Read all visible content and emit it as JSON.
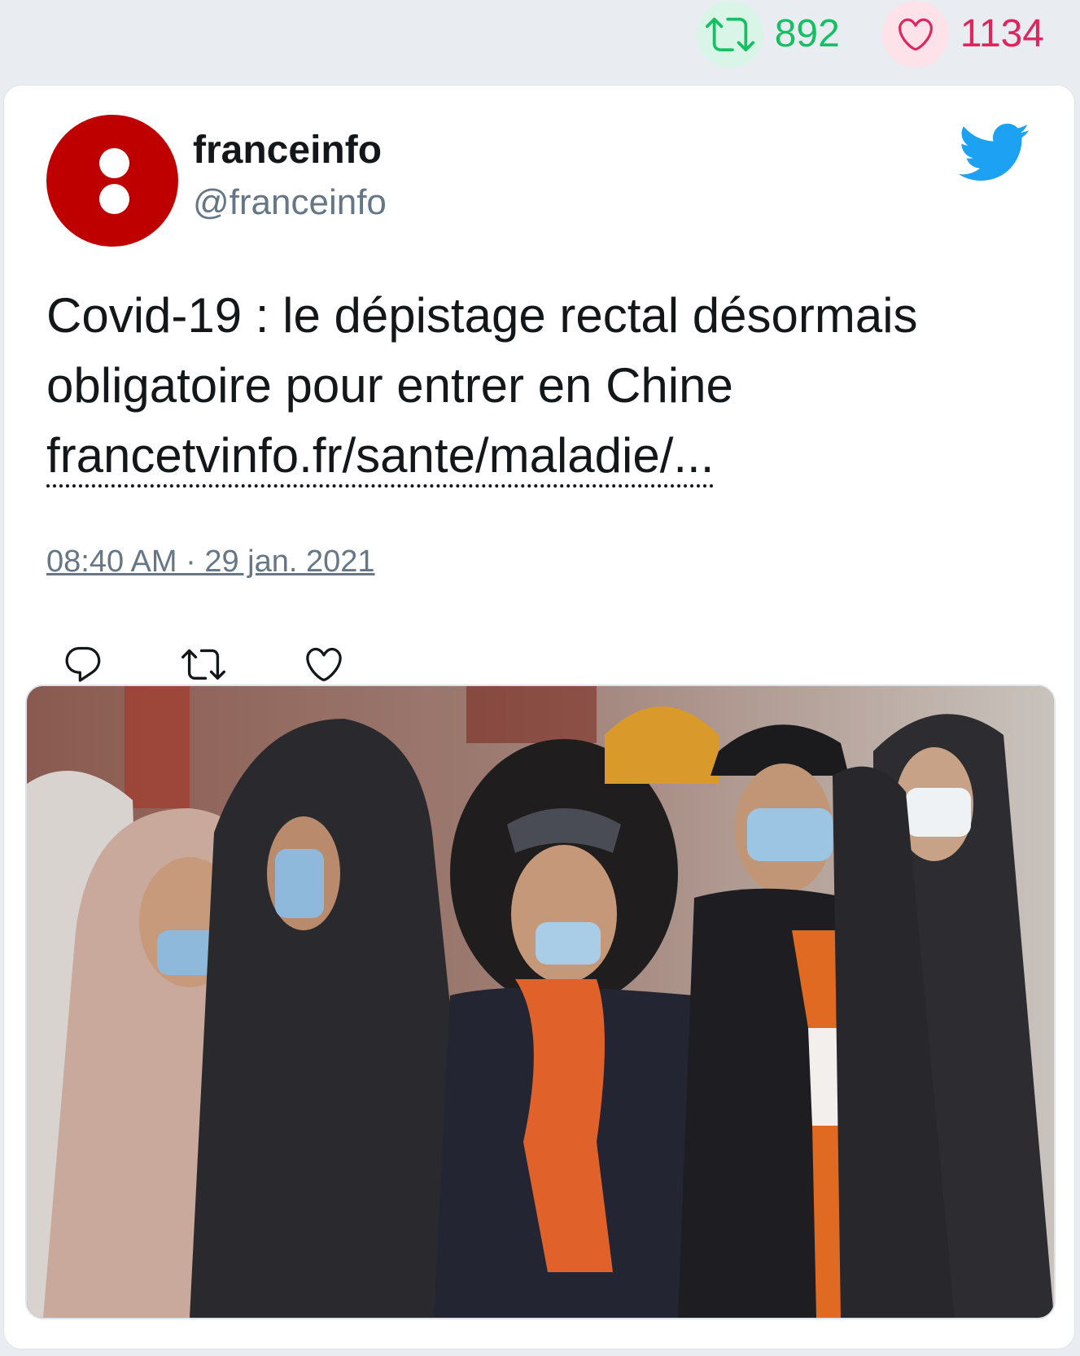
{
  "stats": {
    "retweets": "892",
    "likes": "1134",
    "retweet_icon": "retweet-icon",
    "like_icon": "heart-icon"
  },
  "author": {
    "name": "franceinfo",
    "handle": "@franceinfo",
    "avatar_icon": "franceinfo-logo"
  },
  "tweet": {
    "text": "Covid-19 : le dépistage rectal désormais obligatoire pour entrer en Chine",
    "link": "francetvinfo.fr/sante/maladie/...",
    "timestamp": "08:40 AM · 29 jan. 2021"
  },
  "actions": [
    {
      "icon": "reply-icon"
    },
    {
      "icon": "retweet-icon"
    },
    {
      "icon": "like-icon"
    }
  ],
  "media": {
    "icon": "photo"
  },
  "colors": {
    "background": "#e9edf1",
    "card": "#ffffff",
    "retweet_green": "#17bf63",
    "like_red": "#e0245e",
    "twitter_blue": "#1da1f2",
    "avatar_red": "#bf0000",
    "muted_text": "#657786"
  }
}
